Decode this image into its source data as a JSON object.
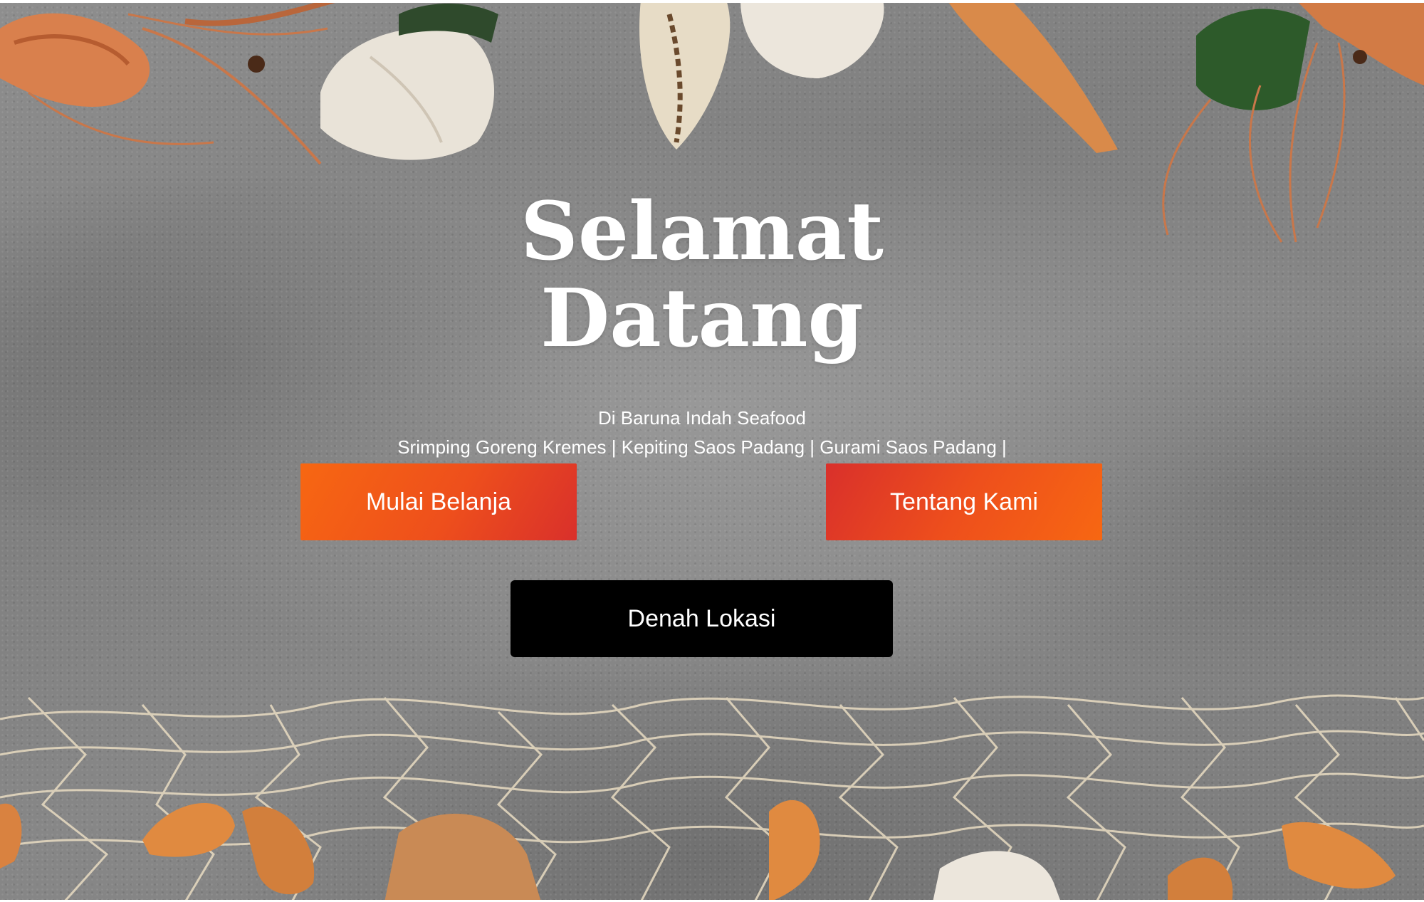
{
  "hero": {
    "title_line1": "Selamat",
    "title_line2": "Datang",
    "subtitle": "Di Baruna Indah Seafood",
    "menu_line": "Srimping Goreng Kremes | Kepiting Saos Padang | Gurami Saos Padang |"
  },
  "buttons": {
    "shop_label": "Mulai Belanja",
    "about_label": "Tentang Kami",
    "map_label": "Denah Lokasi"
  },
  "colors": {
    "accent_orange": "#f76712",
    "accent_red": "#d9302b",
    "map_button": "#000000",
    "text": "#ffffff"
  }
}
